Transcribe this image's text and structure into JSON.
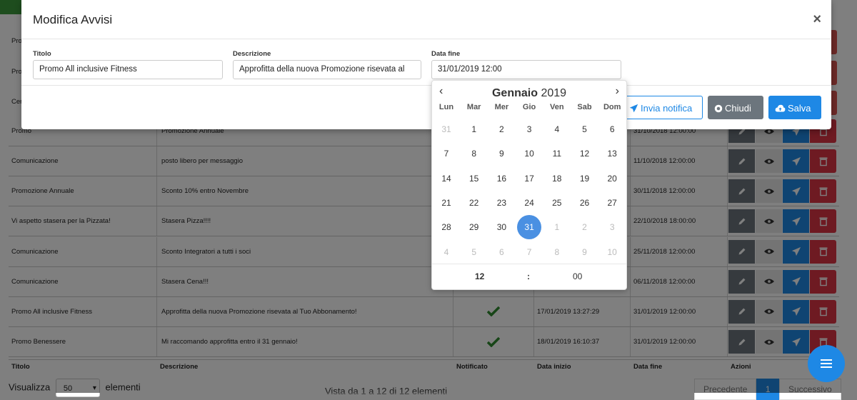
{
  "table": {
    "rows": [
      {
        "titolo": "Promo",
        "descrizione": "Promozione Annuale",
        "notificato": false,
        "data_inizio": "",
        "data_fine": "31/10/2018 12:00:00"
      },
      {
        "titolo": "Comunicazione",
        "descrizione": "posto libero per messaggio",
        "notificato": false,
        "data_inizio": "",
        "data_fine": "11/10/2018 12:00:00"
      },
      {
        "titolo": "Promozione Annuale",
        "descrizione": "Sconto 10% entro Novembre",
        "notificato": false,
        "data_inizio": "",
        "data_fine": "30/11/2018 12:00:00"
      },
      {
        "titolo": "Vi aspetto stasera per la Pizzata!",
        "descrizione": "Stasera Pizza!!!!",
        "notificato": false,
        "data_inizio": "",
        "data_fine": "22/10/2018 18:00:00"
      },
      {
        "titolo": "Comunicazione",
        "descrizione": "Sconto Integratori a tutti i soci",
        "notificato": false,
        "data_inizio": "",
        "data_fine": "25/11/2018 12:00:00"
      },
      {
        "titolo": "Comunicazione",
        "descrizione": "Stasera Cena!!!",
        "notificato": false,
        "data_inizio": "",
        "data_fine": "06/11/2018 12:00:00"
      },
      {
        "titolo": "Promo All inclusive Fitness",
        "descrizione": "Approfitta della nuova Promozione risevata al Tuo Abbonamento!",
        "notificato": true,
        "data_inizio": "17/01/2019 13:27:29",
        "data_fine": "31/01/2019 12:00:00"
      },
      {
        "titolo": "Promo Benessere",
        "descrizione": "Mi raccomando approfitta entro il 31 gennaio!",
        "notificato": true,
        "data_inizio": "18/01/2019 16:10:37",
        "data_fine": "31/01/2019 12:00:00"
      }
    ],
    "footer_headers": {
      "titolo": "Titolo",
      "descrizione": "Descrizione",
      "notificato": "Notificato",
      "data_inizio": "Data inizio",
      "data_fine": "Data fine",
      "azioni": "Azioni"
    },
    "top_partial_labels": [
      "Pro",
      "Pro",
      "Cer"
    ]
  },
  "bottom": {
    "show_prefix": "Visualizza",
    "length_value": "50",
    "show_suffix": "elementi",
    "info": "Vista da 1 a 12 di 12 elementi",
    "prev": "Precedente",
    "page": "1",
    "next": "Successivo"
  },
  "modal": {
    "title": "Modifica Avvisi",
    "close_glyph": "×",
    "fields": {
      "titolo_label": "Titolo",
      "titolo_value": "Promo All inclusive Fitness",
      "descrizione_label": "Descrizione",
      "descrizione_value": "Approfitta della nuova Promozione risevata al",
      "data_fine_label": "Data fine",
      "data_fine_value": "31/01/2019 12:00"
    },
    "buttons": {
      "invia": "Invia notifica",
      "chiudi": "Chiudi",
      "salva": "Salva"
    }
  },
  "calendar": {
    "month": "Gennaio",
    "year": "2019",
    "dow": [
      "Lun",
      "Mar",
      "Mer",
      "Gio",
      "Ven",
      "Sab",
      "Dom"
    ],
    "weeks": [
      [
        {
          "d": "31",
          "m": true
        },
        {
          "d": "1"
        },
        {
          "d": "2"
        },
        {
          "d": "3"
        },
        {
          "d": "4"
        },
        {
          "d": "5"
        },
        {
          "d": "6"
        }
      ],
      [
        {
          "d": "7"
        },
        {
          "d": "8"
        },
        {
          "d": "9"
        },
        {
          "d": "10"
        },
        {
          "d": "11"
        },
        {
          "d": "12"
        },
        {
          "d": "13"
        }
      ],
      [
        {
          "d": "14"
        },
        {
          "d": "15"
        },
        {
          "d": "16"
        },
        {
          "d": "17"
        },
        {
          "d": "18"
        },
        {
          "d": "19"
        },
        {
          "d": "20"
        }
      ],
      [
        {
          "d": "21"
        },
        {
          "d": "22"
        },
        {
          "d": "23"
        },
        {
          "d": "24"
        },
        {
          "d": "25"
        },
        {
          "d": "26"
        },
        {
          "d": "27"
        }
      ],
      [
        {
          "d": "28"
        },
        {
          "d": "29"
        },
        {
          "d": "30"
        },
        {
          "d": "31",
          "s": true
        },
        {
          "d": "1",
          "m": true
        },
        {
          "d": "2",
          "m": true
        },
        {
          "d": "3",
          "m": true
        }
      ],
      [
        {
          "d": "4",
          "m": true
        },
        {
          "d": "5",
          "m": true
        },
        {
          "d": "6",
          "m": true
        },
        {
          "d": "7",
          "m": true
        },
        {
          "d": "8",
          "m": true
        },
        {
          "d": "9",
          "m": true
        },
        {
          "d": "10",
          "m": true
        }
      ]
    ],
    "hour": "12",
    "sep": ":",
    "minute": "00"
  },
  "colors": {
    "primary": "#1e88e5",
    "danger": "#dc3545",
    "secondary": "#6c757d",
    "success": "#2e8b2e",
    "selected_day": "#4a90e2"
  }
}
